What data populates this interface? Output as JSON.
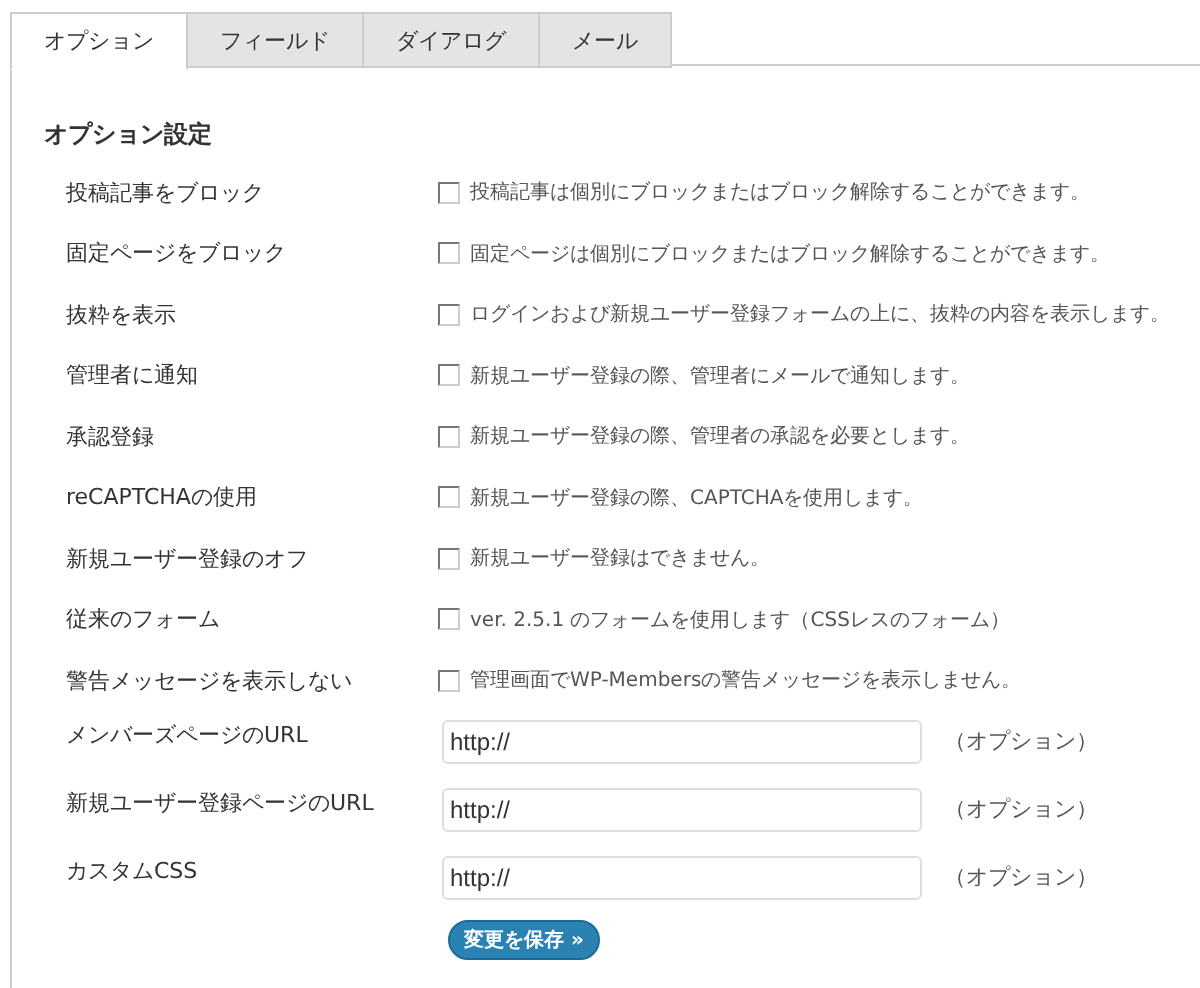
{
  "tabs": [
    {
      "label": "オプション",
      "selected": true
    },
    {
      "label": "フィールド",
      "selected": false
    },
    {
      "label": "ダイアログ",
      "selected": false
    },
    {
      "label": "メール",
      "selected": false
    }
  ],
  "heading": "オプション設定",
  "options": [
    {
      "label": "投稿記事をブロック",
      "description": "投稿記事は個別にブロックまたはブロック解除することができます。",
      "checked": false
    },
    {
      "label": "固定ページをブロック",
      "description": "固定ページは個別にブロックまたはブロック解除することができます。",
      "checked": false
    },
    {
      "label": "抜粋を表示",
      "description": "ログインおよび新規ユーザー登録フォームの上に、抜粋の内容を表示します。",
      "checked": false
    },
    {
      "label": "管理者に通知",
      "description": "新規ユーザー登録の際、管理者にメールで通知します。",
      "checked": false
    },
    {
      "label": "承認登録",
      "description": "新規ユーザー登録の際、管理者の承認を必要とします。",
      "checked": false
    },
    {
      "label": "reCAPTCHAの使用",
      "description": "新規ユーザー登録の際、CAPTCHAを使用します。",
      "checked": false
    },
    {
      "label": "新規ユーザー登録のオフ",
      "description": "新規ユーザー登録はできません。",
      "checked": false
    },
    {
      "label": "従来のフォーム",
      "description": "ver. 2.5.1 のフォームを使用します（CSSレスのフォーム）",
      "checked": false
    },
    {
      "label": "警告メッセージを表示しない",
      "description": "管理画面でWP-Membersの警告メッセージを表示しません。",
      "checked": false
    }
  ],
  "url_fields": [
    {
      "label": "メンバーズページのURL",
      "value": "http://",
      "note": "（オプション）"
    },
    {
      "label": "新規ユーザー登録ページのURL",
      "value": "http://",
      "note": "（オプション）"
    },
    {
      "label": "カスタムCSS",
      "value": "http://",
      "note": "（オプション）"
    }
  ],
  "save_button": "変更を保存 »"
}
